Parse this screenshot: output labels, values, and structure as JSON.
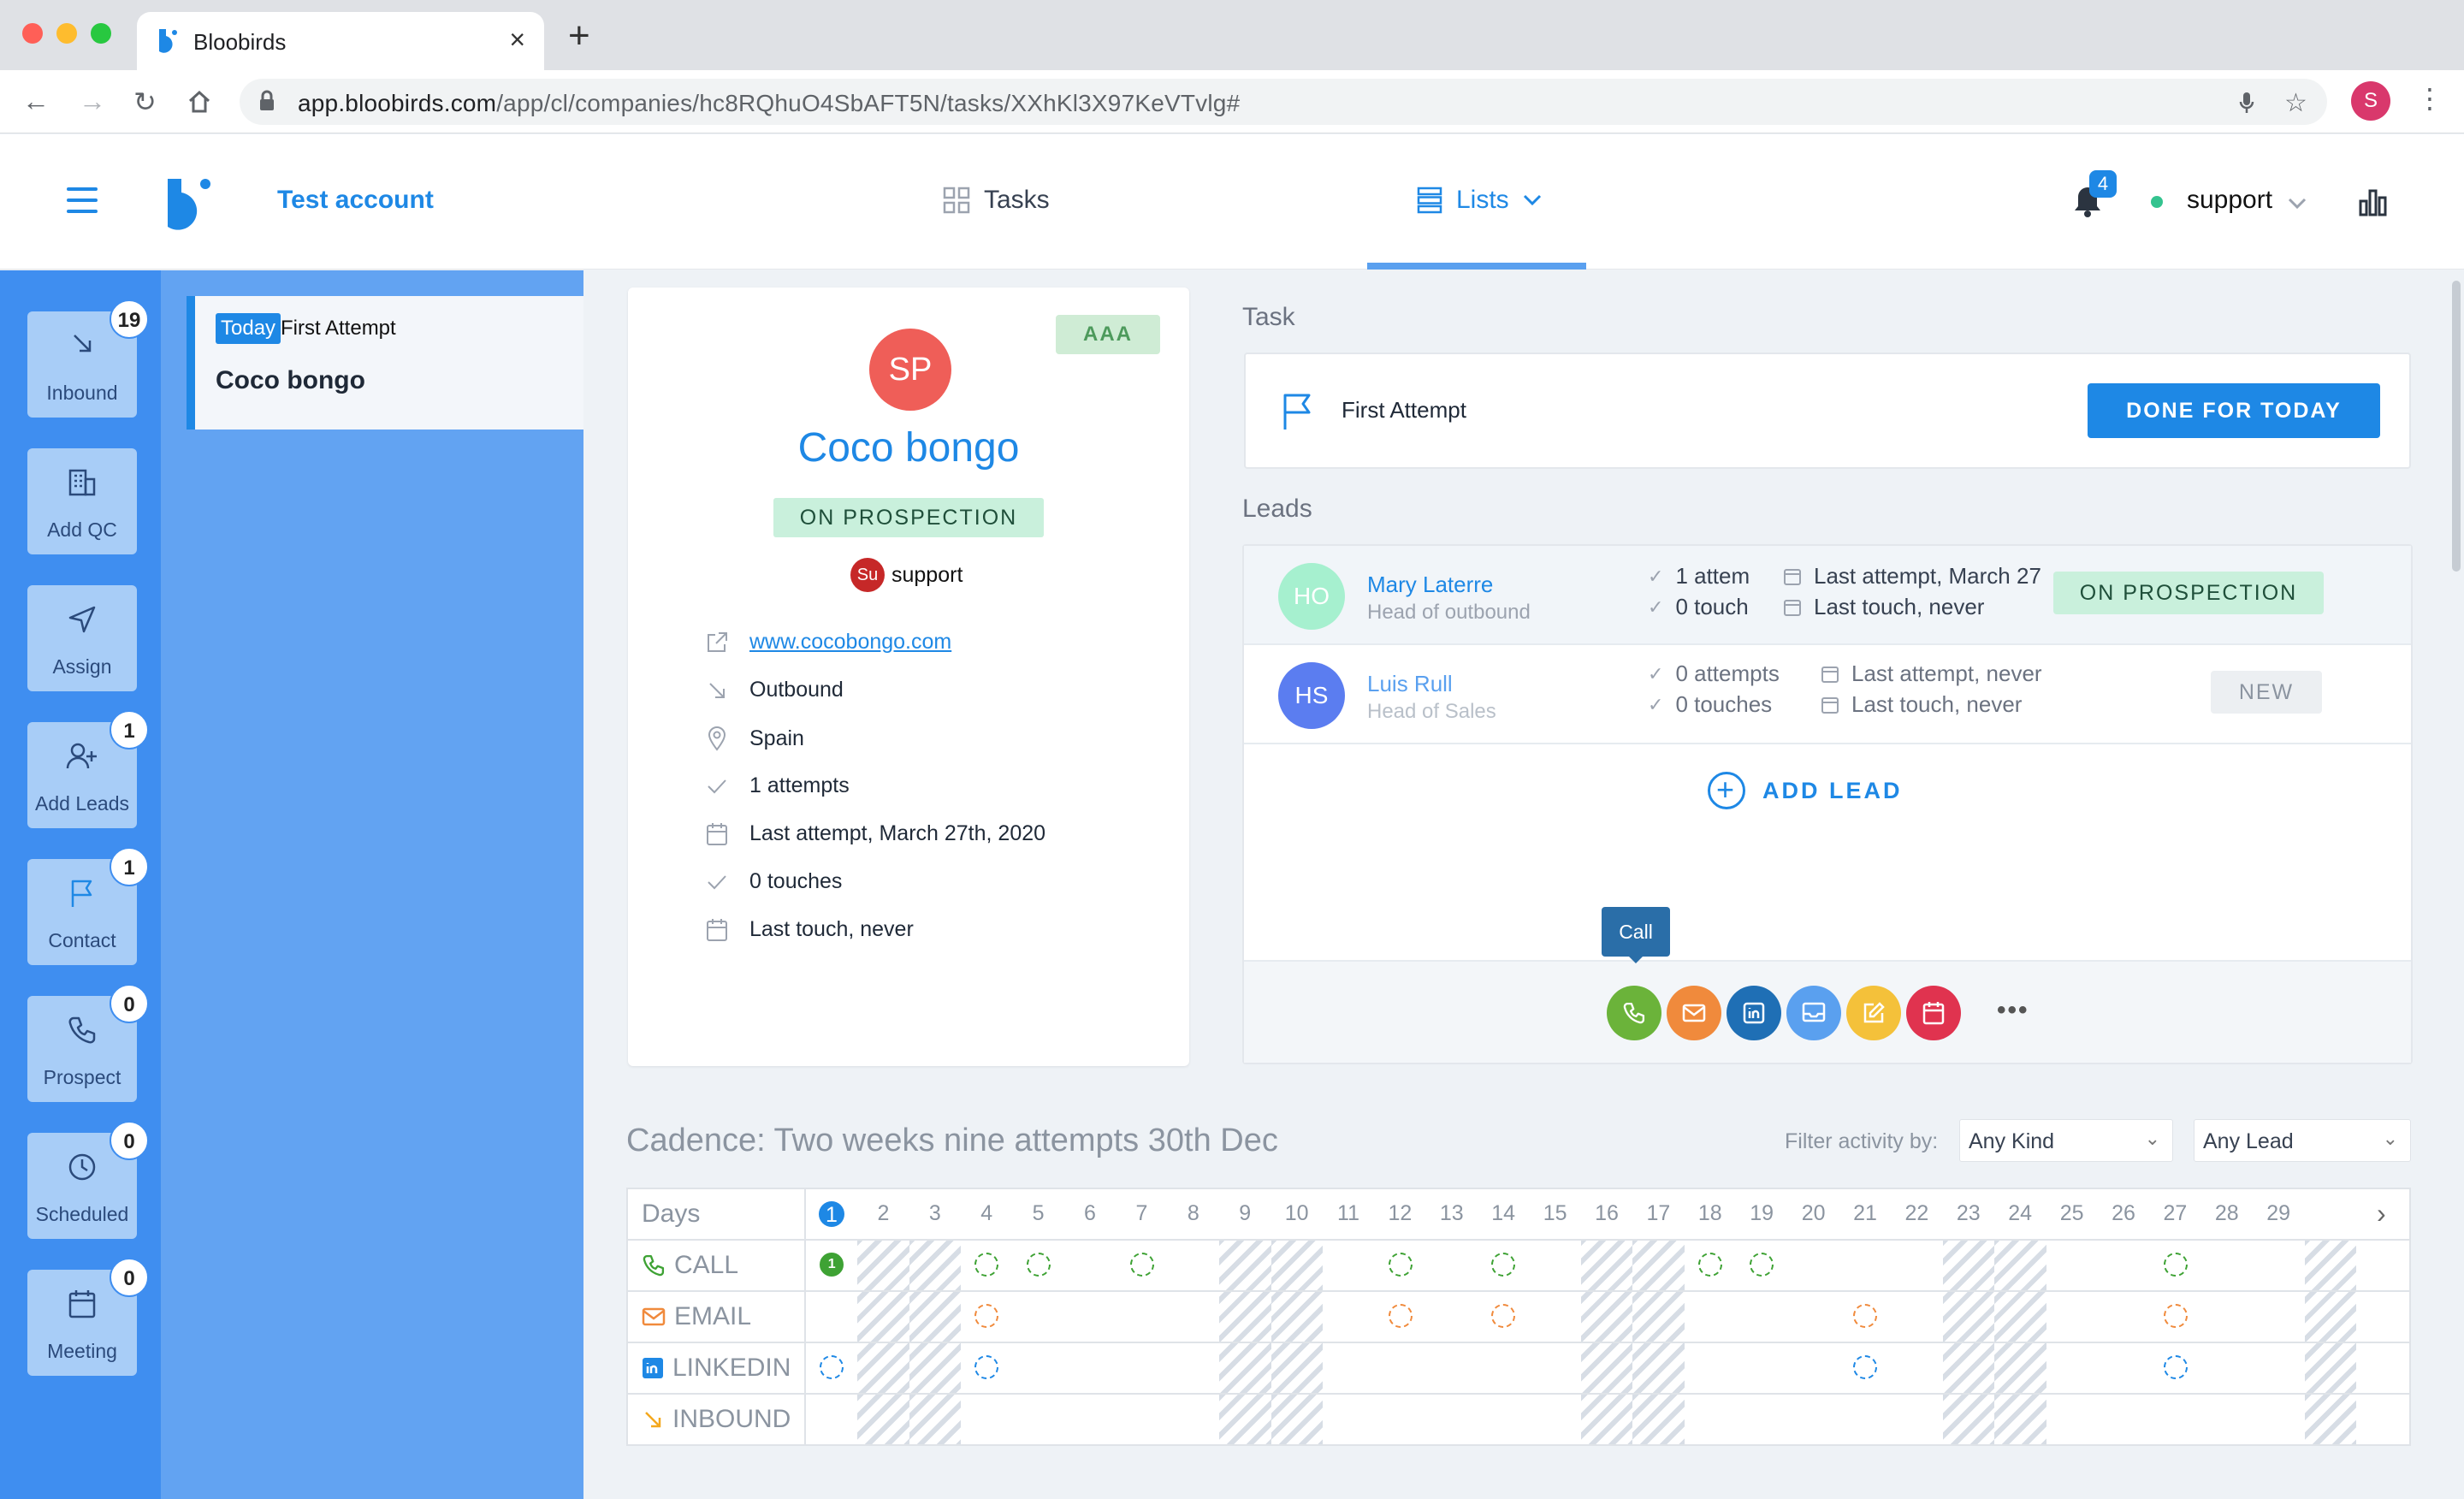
{
  "browser": {
    "tab_title": "Bloobirds",
    "url_host": "app.bloobirds.com",
    "url_path": "/app/cl/companies/hc8RQhuO4SbAFT5N/tasks/XXhKl3X97KeVTvlg#",
    "profile_initial": "S"
  },
  "header": {
    "account_name": "Test account",
    "tasks_label": "Tasks",
    "lists_label": "Lists",
    "notification_count": "4",
    "user_name": "support",
    "colors": {
      "brand": "#1e88e5",
      "online": "#34c38f"
    }
  },
  "rail": {
    "items": [
      {
        "label": "Inbound",
        "count": "19",
        "icon": "arrow-down-right-icon"
      },
      {
        "label": "Add QC",
        "count": "",
        "icon": "building-icon"
      },
      {
        "label": "Assign",
        "count": "",
        "icon": "send-icon"
      },
      {
        "label": "Add Leads",
        "count": "1",
        "icon": "user-plus-icon"
      },
      {
        "label": "Contact",
        "count": "1",
        "icon": "flag-icon"
      },
      {
        "label": "Prospect",
        "count": "0",
        "icon": "phone-icon"
      },
      {
        "label": "Scheduled",
        "count": "0",
        "icon": "clock-icon"
      },
      {
        "label": "Meeting",
        "count": "0",
        "icon": "calendar-icon"
      }
    ]
  },
  "task_list": {
    "items": [
      {
        "badge": "Today",
        "type": "First Attempt",
        "company": "Coco bongo"
      }
    ]
  },
  "company": {
    "rating": "AAA",
    "initials": "SP",
    "name": "Coco bongo",
    "status": "ON PROSPECTION",
    "owner_initials": "Su",
    "owner_name": "support",
    "website": "www.cocobongo.com",
    "source": "Outbound",
    "country": "Spain",
    "attempts": "1 attempts",
    "last_attempt": "Last attempt, March 27th, 2020",
    "touches": "0 touches",
    "last_touch": "Last touch, never"
  },
  "task": {
    "section_title": "Task",
    "name": "First Attempt",
    "done_label": "DONE FOR TODAY"
  },
  "leads": {
    "section_title": "Leads",
    "items": [
      {
        "initials": "HO",
        "name": "Mary Laterre",
        "title": "Head of outbound",
        "attempts": "1 attem",
        "touches": "0 touch",
        "last_attempt": "Last attempt, March 27",
        "last_touch": "Last touch, never",
        "status": "ON PROSPECTION",
        "avatar_color": "#a6f0cf"
      },
      {
        "initials": "HS",
        "name": "Luis Rull",
        "title": "Head of Sales",
        "attempts": "0 attempts",
        "touches": "0 touches",
        "last_attempt": "Last attempt, never",
        "last_touch": "Last touch, never",
        "status": "NEW",
        "avatar_color": "#5b7df0"
      }
    ],
    "add_lead_label": "ADD LEAD",
    "tooltip": "Call",
    "actions": [
      {
        "icon": "phone-icon",
        "color": "#6bb33a"
      },
      {
        "icon": "email-icon",
        "color": "#f08a3c"
      },
      {
        "icon": "linkedin-icon",
        "color": "#1f6fb5"
      },
      {
        "icon": "inbox-icon",
        "color": "#5aa0ef"
      },
      {
        "icon": "note-icon",
        "color": "#f4c13a"
      },
      {
        "icon": "calendar-icon",
        "color": "#e0334f"
      }
    ],
    "more_label": "•••"
  },
  "cadence": {
    "title": "Cadence: Two weeks nine attempts 30th Dec",
    "filter_label": "Filter activity by:",
    "filter_kind": "Any Kind",
    "filter_lead": "Any Lead",
    "days_label": "Days",
    "days": [
      "1",
      "2",
      "3",
      "4",
      "5",
      "6",
      "7",
      "8",
      "9",
      "10",
      "11",
      "12",
      "13",
      "14",
      "15",
      "16",
      "17",
      "18",
      "19",
      "20",
      "21",
      "22",
      "23",
      "24",
      "25",
      "26",
      "27",
      "28",
      "29"
    ],
    "today_day": 1,
    "weekend_days": [
      2,
      3,
      9,
      10,
      16,
      17,
      23,
      24,
      30
    ],
    "channels": [
      {
        "label": "CALL",
        "icon": "phone-icon",
        "color": "#3ea234",
        "days": [
          4,
          5,
          7,
          12,
          14,
          18,
          19,
          27
        ],
        "done": {
          "day": 1,
          "count": "1"
        }
      },
      {
        "label": "EMAIL",
        "icon": "email-icon",
        "color": "#f08a3c",
        "days": [
          4,
          12,
          14,
          21,
          27
        ]
      },
      {
        "label": "LINKEDIN",
        "icon": "linkedin-icon",
        "color": "#1e88e5",
        "days": [
          1,
          4,
          21,
          27
        ]
      },
      {
        "label": "INBOUND",
        "icon": "arrow-down-right-icon",
        "color": "#f4a81d",
        "days": []
      }
    ]
  }
}
